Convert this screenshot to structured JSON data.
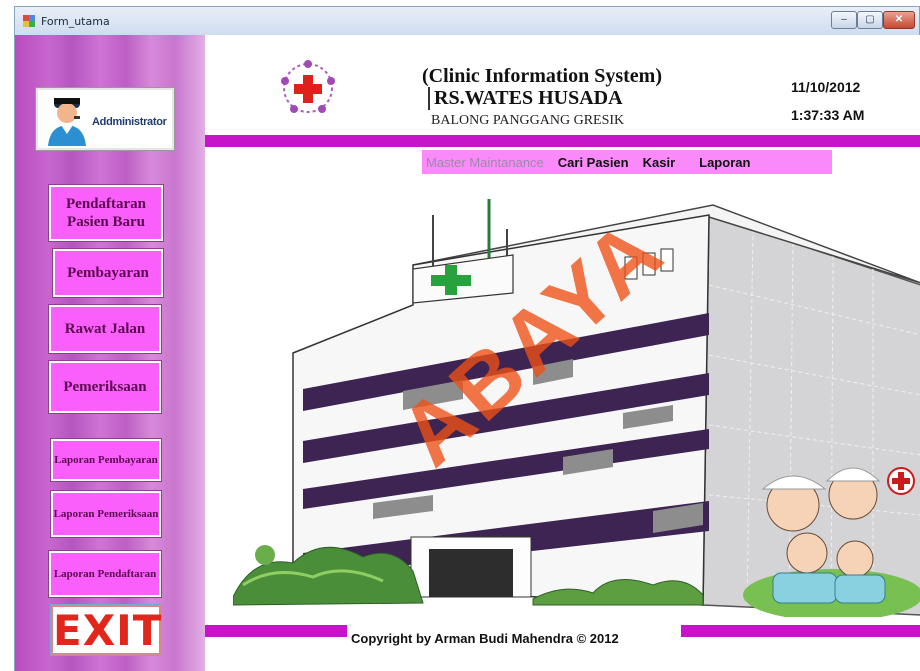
{
  "window": {
    "title": "Form_utama",
    "controls": {
      "minimize": "–",
      "maximize": "▢",
      "close": "✕"
    }
  },
  "sidebar": {
    "user_label": "Addministrator",
    "buttons": [
      {
        "label": "Pendaftaran Pasien Baru"
      },
      {
        "label": "Pembayaran"
      },
      {
        "label": "Rawat Jalan"
      },
      {
        "label": "Pemeriksaan"
      },
      {
        "label": "Laporan Pembayaran"
      },
      {
        "label": "Laporan Pemeriksaan"
      },
      {
        "label": "Laporan Pendaftaran"
      }
    ],
    "exit_label": "EXIT"
  },
  "header": {
    "system_title": "(Clinic Information System)",
    "hospital_name": "RS.WATES HUSADA",
    "address": "BALONG PANGGANG GRESIK",
    "date": "11/10/2012",
    "time": "1:37:33 AM"
  },
  "menu": {
    "items": [
      {
        "label": "Master Maintanance",
        "enabled": false
      },
      {
        "label": "Cari Pasien",
        "enabled": true
      },
      {
        "label": "Kasir",
        "enabled": true
      },
      {
        "label": "Laporan",
        "enabled": true
      }
    ]
  },
  "footer": {
    "copyright": "Copyright by Arman Budi Mahendra © 2012"
  },
  "watermark": "ABAYA",
  "colors": {
    "accent": "#c814c8",
    "button_fill": "#fb5ffb",
    "menu_fill": "#fa8afa",
    "exit_text": "#e1271b"
  }
}
